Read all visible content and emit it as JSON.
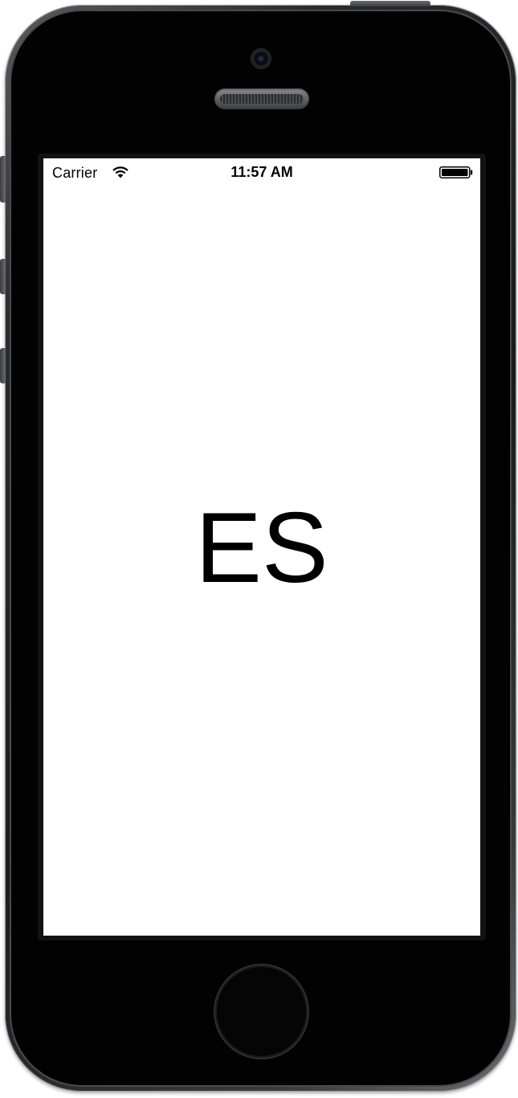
{
  "status_bar": {
    "carrier": "Carrier",
    "time": "11:57 AM"
  },
  "main": {
    "label": "ES"
  },
  "icons": {
    "wifi": "wifi-icon",
    "battery": "battery-icon"
  }
}
